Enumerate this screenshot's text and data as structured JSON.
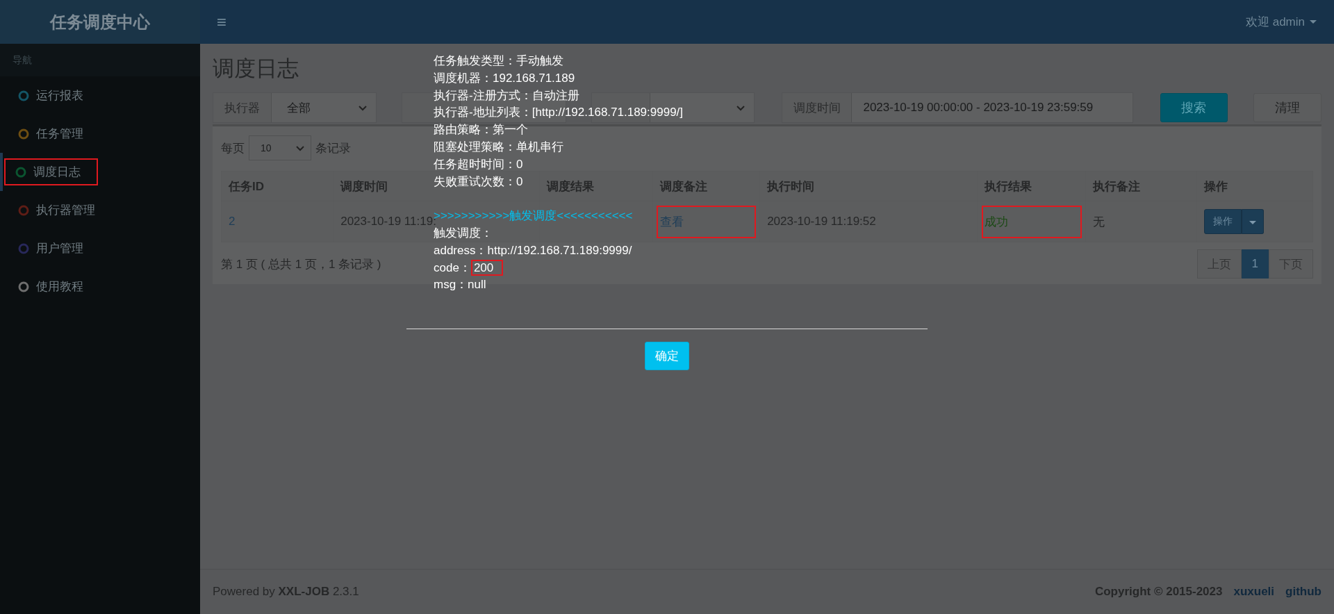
{
  "brand": {
    "title": "任务调度中心"
  },
  "header": {
    "menu_glyph": "≡",
    "user": "欢迎 admin"
  },
  "sidebar": {
    "heading": "导航",
    "items": [
      {
        "label": "运行报表",
        "color": "#145566",
        "selected": false,
        "highlighted": false
      },
      {
        "label": "任务管理",
        "color": "#6e4e12",
        "selected": false,
        "highlighted": false
      },
      {
        "label": "调度日志",
        "color": "#0b5530",
        "selected": true,
        "highlighted": true
      },
      {
        "label": "执行器管理",
        "color": "#5e1d16",
        "selected": false,
        "highlighted": false
      },
      {
        "label": "用户管理",
        "color": "#28285a",
        "selected": false,
        "highlighted": false
      },
      {
        "label": "使用教程",
        "color": "#6e6e6e",
        "selected": false,
        "highlighted": false
      }
    ]
  },
  "page": {
    "title": "调度日志"
  },
  "filters": [
    {
      "kind": "select",
      "label": "执行器",
      "value": "全部"
    },
    {
      "kind": "covered_select"
    },
    {
      "kind": "select"
    },
    {
      "kind": "input",
      "label": "调度时间",
      "value": "2023-10-19 00:00:00 - 2023-10-19 23:59:59"
    }
  ],
  "buttons": [
    {
      "label": "搜索",
      "kind": "primary"
    },
    {
      "label": "清理",
      "kind": "default"
    }
  ],
  "page_size": {
    "prefix": "每页",
    "value": "10",
    "suffix": "条记录"
  },
  "table": {
    "columns": [
      "任务ID",
      "调度时间",
      "调度结果",
      "调度备注",
      "执行时间",
      "执行结果",
      "执行备注",
      "操作"
    ],
    "rows": [
      {
        "cells": [
          {
            "kind": "link",
            "text": "2",
            "highlighted": false
          },
          {
            "kind": "text",
            "text": "2023-10-19 11:19:",
            "highlighted": false
          },
          {
            "kind": "empty",
            "highlighted": false
          },
          {
            "kind": "link",
            "text": "查看",
            "highlighted": true
          },
          {
            "kind": "text",
            "text": "2023-10-19 11:19:52",
            "highlighted": false
          },
          {
            "kind": "success",
            "text": "成功",
            "highlighted": true
          },
          {
            "kind": "text",
            "text": "无",
            "highlighted": false
          },
          {
            "kind": "action",
            "text": "操作",
            "highlighted": false
          }
        ]
      }
    ]
  },
  "summary": "第 1 页 ( 总共 1 页，1 条记录 )",
  "pagination": [
    {
      "label": "上页",
      "selected": false
    },
    {
      "label": "1",
      "selected": true
    },
    {
      "label": "下页",
      "selected": false
    }
  ],
  "footer": {
    "powered": "Powered by **XXL-JOB** 2.3.1",
    "copyright": "Copyright © 2015-2023",
    "links": [
      "xuxueli",
      "github"
    ]
  },
  "dialog": {
    "lines": [
      {
        "kind": "plain",
        "text": "任务触发类型：手动触发"
      },
      {
        "kind": "plain",
        "text": "调度机器：192.168.71.189"
      },
      {
        "kind": "plain",
        "text": "执行器-注册方式：自动注册"
      },
      {
        "kind": "plain",
        "text": "执行器-地址列表：[http://192.168.71.189:9999/]"
      },
      {
        "kind": "plain",
        "text": "路由策略：第一个"
      },
      {
        "kind": "plain",
        "text": "阻塞处理策略：单机串行"
      },
      {
        "kind": "plain",
        "text": "任务超时时间：0"
      },
      {
        "kind": "plain",
        "text": "失败重试次数：0"
      },
      {
        "kind": "banner",
        "text": ">>>>>>>>>>>触发调度<<<<<<<<<<<"
      },
      {
        "kind": "plain",
        "text": "触发调度："
      },
      {
        "kind": "plain",
        "text": "address：http://192.168.71.189:9999/"
      },
      {
        "kind": "boxed",
        "text": "code：",
        "value": "200"
      },
      {
        "kind": "plain",
        "text": "msg：null"
      }
    ],
    "confirm": "确定"
  }
}
